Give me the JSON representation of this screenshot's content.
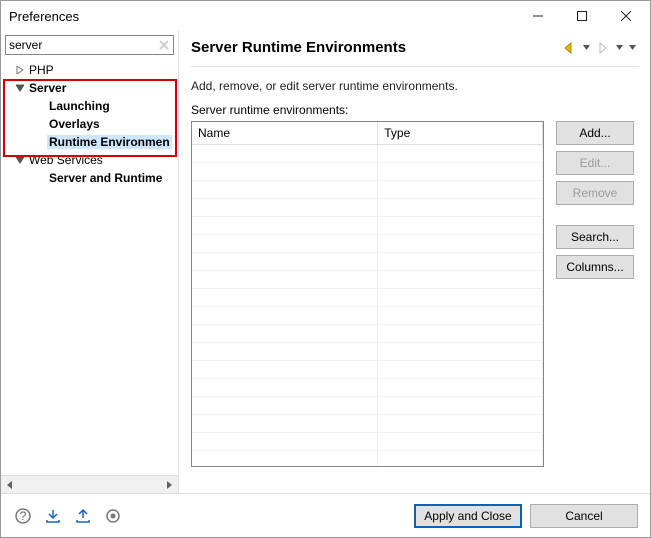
{
  "window": {
    "title": "Preferences"
  },
  "search": {
    "value": "server"
  },
  "tree": {
    "php": "PHP",
    "server": "Server",
    "launching": "Launching",
    "overlays": "Overlays",
    "runtime_env": "Runtime Environmen",
    "web_services": "Web Services",
    "server_and_runtime": "Server and Runtime"
  },
  "page": {
    "title": "Server Runtime Environments",
    "desc": "Add, remove, or edit server runtime environments.",
    "table_label": "Server runtime environments:",
    "columns": {
      "name": "Name",
      "type": "Type"
    }
  },
  "buttons": {
    "add": "Add...",
    "edit": "Edit...",
    "remove": "Remove",
    "search": "Search...",
    "columns": "Columns...",
    "apply_close": "Apply and Close",
    "cancel": "Cancel"
  }
}
